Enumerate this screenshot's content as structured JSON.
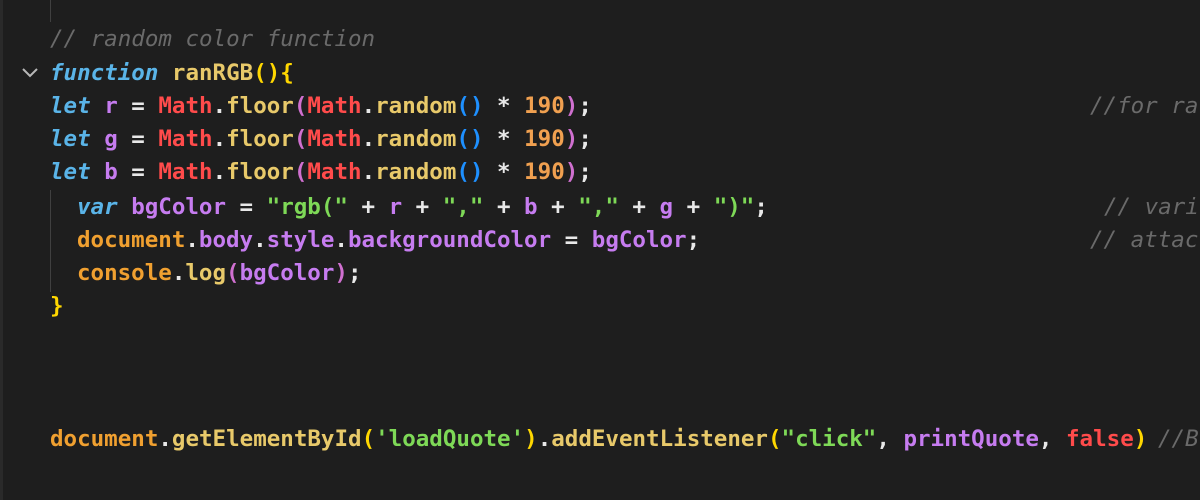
{
  "theme": {
    "background": "#1e1e1e",
    "indent_guide": "#404040",
    "comment": "#6a6a6a",
    "keyword": "#5ab4e8",
    "function_name": "#e8c96a",
    "variable": "#c67cf0",
    "class_name": "#ff4b4b",
    "method": "#e8c96a",
    "number": "#f0a050",
    "string": "#7ed957",
    "bracket_yellow": "#ffd700",
    "bracket_purple": "#d070d0",
    "bracket_blue": "#1e90ff",
    "operator": "#e8e8e8",
    "orange_var": "#f0a030"
  },
  "icons": {
    "fold": "chevron-down-icon"
  },
  "lines": [
    {
      "id": "l1",
      "tokens": [
        {
          "t": "// random color function",
          "c": "comment"
        }
      ]
    },
    {
      "id": "l2",
      "tokens": [
        {
          "t": "function",
          "c": "keyword"
        },
        {
          "t": " ",
          "c": "operator"
        },
        {
          "t": "ranRGB",
          "c": "function_name"
        },
        {
          "t": "(",
          "c": "bracket_yellow"
        },
        {
          "t": ")",
          "c": "bracket_yellow"
        },
        {
          "t": "{",
          "c": "bracket_yellow"
        }
      ]
    },
    {
      "id": "l3",
      "tokens": [
        {
          "t": "let",
          "c": "keyword"
        },
        {
          "t": " ",
          "c": "operator"
        },
        {
          "t": "r",
          "c": "variable"
        },
        {
          "t": " = ",
          "c": "operator"
        },
        {
          "t": "Math",
          "c": "class_name"
        },
        {
          "t": ".",
          "c": "operator"
        },
        {
          "t": "floor",
          "c": "method"
        },
        {
          "t": "(",
          "c": "bracket_purple"
        },
        {
          "t": "Math",
          "c": "class_name"
        },
        {
          "t": ".",
          "c": "operator"
        },
        {
          "t": "random",
          "c": "method"
        },
        {
          "t": "()",
          "c": "bracket_blue"
        },
        {
          "t": " * ",
          "c": "operator"
        },
        {
          "t": "190",
          "c": "number"
        },
        {
          "t": ")",
          "c": "bracket_purple"
        },
        {
          "t": ";",
          "c": "operator"
        }
      ],
      "comment": "//for ra"
    },
    {
      "id": "l4",
      "tokens": [
        {
          "t": "let",
          "c": "keyword"
        },
        {
          "t": " ",
          "c": "operator"
        },
        {
          "t": "g",
          "c": "variable"
        },
        {
          "t": " = ",
          "c": "operator"
        },
        {
          "t": "Math",
          "c": "class_name"
        },
        {
          "t": ".",
          "c": "operator"
        },
        {
          "t": "floor",
          "c": "method"
        },
        {
          "t": "(",
          "c": "bracket_purple"
        },
        {
          "t": "Math",
          "c": "class_name"
        },
        {
          "t": ".",
          "c": "operator"
        },
        {
          "t": "random",
          "c": "method"
        },
        {
          "t": "()",
          "c": "bracket_blue"
        },
        {
          "t": " * ",
          "c": "operator"
        },
        {
          "t": "190",
          "c": "number"
        },
        {
          "t": ")",
          "c": "bracket_purple"
        },
        {
          "t": ";",
          "c": "operator"
        }
      ]
    },
    {
      "id": "l5",
      "tokens": [
        {
          "t": "let",
          "c": "keyword"
        },
        {
          "t": " ",
          "c": "operator"
        },
        {
          "t": "b",
          "c": "variable"
        },
        {
          "t": " = ",
          "c": "operator"
        },
        {
          "t": "Math",
          "c": "class_name"
        },
        {
          "t": ".",
          "c": "operator"
        },
        {
          "t": "floor",
          "c": "method"
        },
        {
          "t": "(",
          "c": "bracket_purple"
        },
        {
          "t": "Math",
          "c": "class_name"
        },
        {
          "t": ".",
          "c": "operator"
        },
        {
          "t": "random",
          "c": "method"
        },
        {
          "t": "()",
          "c": "bracket_blue"
        },
        {
          "t": " * ",
          "c": "operator"
        },
        {
          "t": "190",
          "c": "number"
        },
        {
          "t": ")",
          "c": "bracket_purple"
        },
        {
          "t": ";",
          "c": "operator"
        }
      ]
    },
    {
      "id": "l6",
      "indent": 1,
      "tokens": [
        {
          "t": "var",
          "c": "keyword"
        },
        {
          "t": " ",
          "c": "operator"
        },
        {
          "t": "bgColor",
          "c": "variable"
        },
        {
          "t": " = ",
          "c": "operator"
        },
        {
          "t": "\"rgb(\"",
          "c": "string"
        },
        {
          "t": " + ",
          "c": "operator"
        },
        {
          "t": "r",
          "c": "variable"
        },
        {
          "t": " + ",
          "c": "operator"
        },
        {
          "t": "\",\"",
          "c": "string"
        },
        {
          "t": " + ",
          "c": "operator"
        },
        {
          "t": "b",
          "c": "variable"
        },
        {
          "t": " + ",
          "c": "operator"
        },
        {
          "t": "\",\"",
          "c": "string"
        },
        {
          "t": " + ",
          "c": "operator"
        },
        {
          "t": "g",
          "c": "variable"
        },
        {
          "t": " + ",
          "c": "operator"
        },
        {
          "t": "\")\"",
          "c": "string"
        },
        {
          "t": ";",
          "c": "operator"
        }
      ],
      "comment": "// vari"
    },
    {
      "id": "l7",
      "indent": 1,
      "tokens": [
        {
          "t": "document",
          "c": "orange_var"
        },
        {
          "t": ".",
          "c": "operator"
        },
        {
          "t": "body",
          "c": "variable"
        },
        {
          "t": ".",
          "c": "operator"
        },
        {
          "t": "style",
          "c": "variable"
        },
        {
          "t": ".",
          "c": "operator"
        },
        {
          "t": "backgroundColor",
          "c": "variable"
        },
        {
          "t": " = ",
          "c": "operator"
        },
        {
          "t": "bgColor",
          "c": "variable"
        },
        {
          "t": ";",
          "c": "operator"
        }
      ],
      "comment": "// attac"
    },
    {
      "id": "l8",
      "indent": 1,
      "tokens": [
        {
          "t": "console",
          "c": "orange_var"
        },
        {
          "t": ".",
          "c": "operator"
        },
        {
          "t": "log",
          "c": "method"
        },
        {
          "t": "(",
          "c": "bracket_purple"
        },
        {
          "t": "bgColor",
          "c": "variable"
        },
        {
          "t": ")",
          "c": "bracket_purple"
        },
        {
          "t": ";",
          "c": "operator"
        }
      ]
    },
    {
      "id": "l9",
      "tokens": [
        {
          "t": "}",
          "c": "bracket_yellow"
        }
      ]
    },
    {
      "id": "l10",
      "tokens": []
    },
    {
      "id": "l11",
      "tokens": []
    },
    {
      "id": "l12",
      "tokens": []
    },
    {
      "id": "l13",
      "tokens": [
        {
          "t": "document",
          "c": "orange_var"
        },
        {
          "t": ".",
          "c": "operator"
        },
        {
          "t": "getElementById",
          "c": "method"
        },
        {
          "t": "(",
          "c": "bracket_yellow"
        },
        {
          "t": "'loadQuote'",
          "c": "string"
        },
        {
          "t": ")",
          "c": "bracket_yellow"
        },
        {
          "t": ".",
          "c": "operator"
        },
        {
          "t": "addEventListener",
          "c": "method"
        },
        {
          "t": "(",
          "c": "bracket_yellow"
        },
        {
          "t": "\"click\"",
          "c": "string"
        },
        {
          "t": ", ",
          "c": "operator"
        },
        {
          "t": "printQuote",
          "c": "variable"
        },
        {
          "t": ", ",
          "c": "operator"
        },
        {
          "t": "false",
          "c": "class_name"
        },
        {
          "t": ")",
          "c": "bracket_yellow"
        }
      ],
      "comment": "//B"
    }
  ]
}
